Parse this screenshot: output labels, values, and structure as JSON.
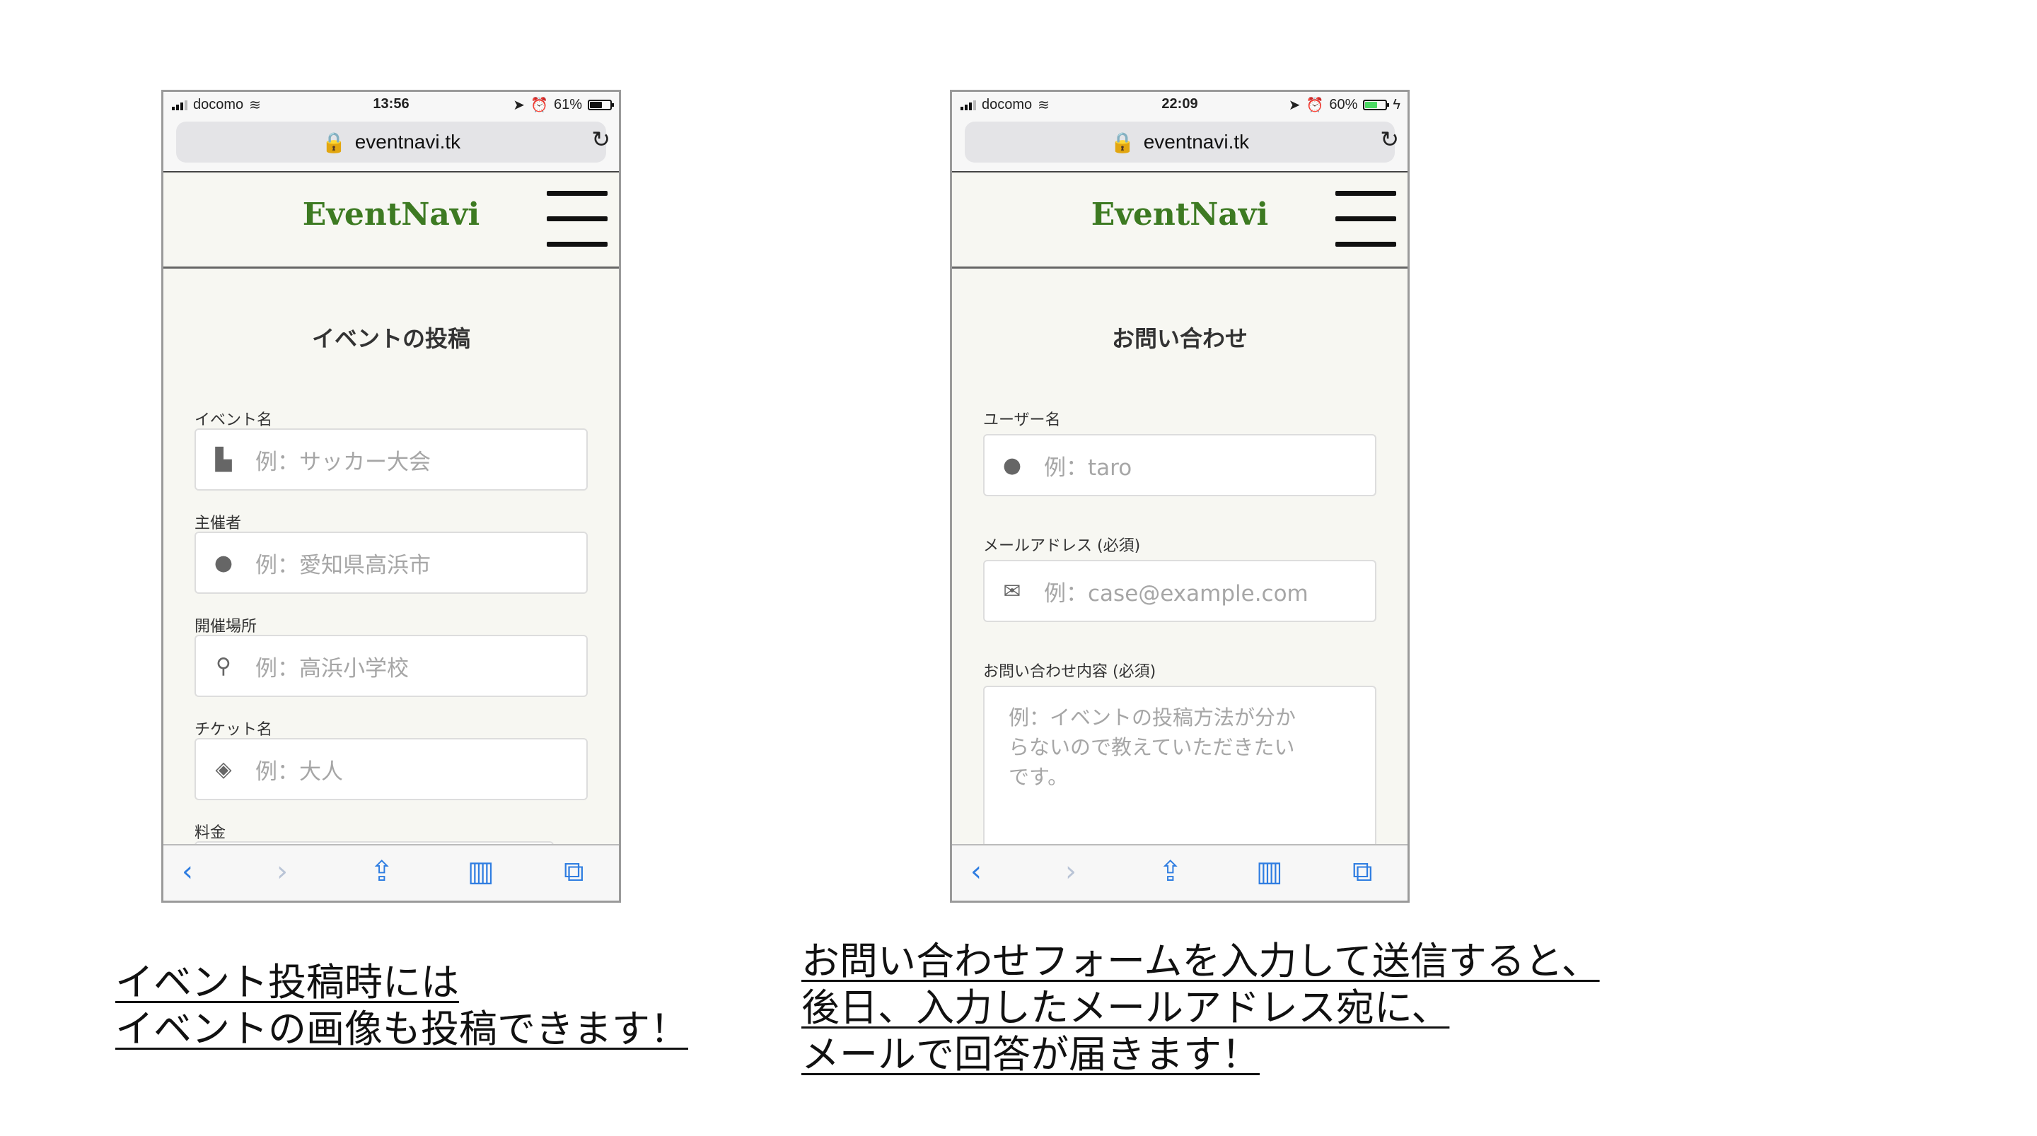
{
  "phone_left": {
    "status": {
      "carrier": "docomo",
      "time": "13:56",
      "battery": "61%"
    },
    "url": "eventnavi.tk",
    "brand": "EventNavi",
    "page_title": "イベントの投稿",
    "fields": [
      {
        "label": "イベント名",
        "placeholder": "例：サッカー大会",
        "icon": "file-icon"
      },
      {
        "label": "主催者",
        "placeholder": "例：愛知県高浜市",
        "icon": "user-icon"
      },
      {
        "label": "開催場所",
        "placeholder": "例：高浜小学校",
        "icon": "map-pin-icon"
      },
      {
        "label": "チケット名",
        "placeholder": "例：大人",
        "icon": "ticket-icon"
      },
      {
        "label": "料金"
      }
    ]
  },
  "phone_right": {
    "status": {
      "carrier": "docomo",
      "time": "22:09",
      "battery": "60%"
    },
    "url": "eventnavi.tk",
    "brand": "EventNavi",
    "page_title": "お問い合わせ",
    "fields": [
      {
        "label": "ユーザー名",
        "placeholder": "例：taro",
        "icon": "user-icon"
      },
      {
        "label": "メールアドレス (必須)",
        "placeholder": "例：case@example.com",
        "icon": "envelope-icon"
      },
      {
        "label": "お問い合わせ内容 (必須)",
        "placeholder_lines": [
          "例：イベントの投稿方法が分か",
          "らないので教えていただきたい",
          "です。"
        ]
      }
    ]
  },
  "captions": {
    "left": [
      "イベント投稿時には",
      "イベントの画像も投稿できます！"
    ],
    "right": [
      "お問い合わせフォームを入力して送信すると、",
      "後日、入力したメールアドレス宛に、",
      "メールで回答が届きます！"
    ]
  },
  "colors": {
    "brand": "#3d7a22",
    "toolbar_icons": "#2f7de1"
  }
}
